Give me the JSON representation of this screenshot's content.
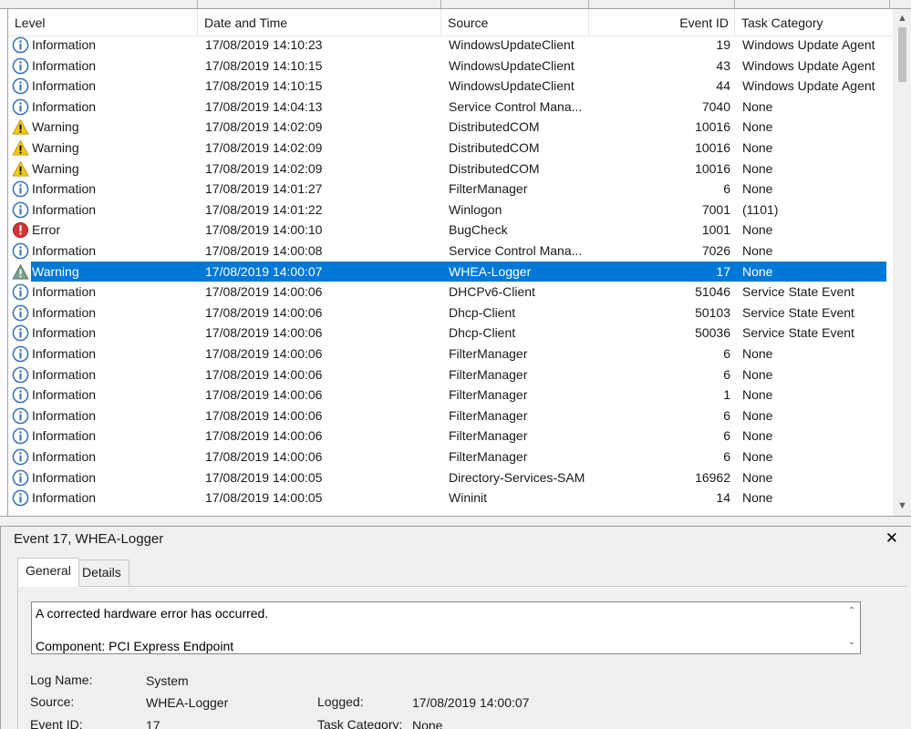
{
  "grid": {
    "columns": [
      {
        "label": "Level"
      },
      {
        "label": "Date and Time"
      },
      {
        "label": "Source"
      },
      {
        "label": "Event ID"
      },
      {
        "label": "Task Category"
      }
    ],
    "rows": [
      {
        "level": "Information",
        "icon": "info-icon",
        "date": "17/08/2019 14:10:23",
        "source": "WindowsUpdateClient",
        "id": "19",
        "task": "Windows Update Agent"
      },
      {
        "level": "Information",
        "icon": "info-icon",
        "date": "17/08/2019 14:10:15",
        "source": "WindowsUpdateClient",
        "id": "43",
        "task": "Windows Update Agent"
      },
      {
        "level": "Information",
        "icon": "info-icon",
        "date": "17/08/2019 14:10:15",
        "source": "WindowsUpdateClient",
        "id": "44",
        "task": "Windows Update Agent"
      },
      {
        "level": "Information",
        "icon": "info-icon",
        "date": "17/08/2019 14:04:13",
        "source": "Service Control Mana...",
        "id": "7040",
        "task": "None"
      },
      {
        "level": "Warning",
        "icon": "warning-icon",
        "date": "17/08/2019 14:02:09",
        "source": "DistributedCOM",
        "id": "10016",
        "task": "None"
      },
      {
        "level": "Warning",
        "icon": "warning-icon",
        "date": "17/08/2019 14:02:09",
        "source": "DistributedCOM",
        "id": "10016",
        "task": "None"
      },
      {
        "level": "Warning",
        "icon": "warning-icon",
        "date": "17/08/2019 14:02:09",
        "source": "DistributedCOM",
        "id": "10016",
        "task": "None"
      },
      {
        "level": "Information",
        "icon": "info-icon",
        "date": "17/08/2019 14:01:27",
        "source": "FilterManager",
        "id": "6",
        "task": "None"
      },
      {
        "level": "Information",
        "icon": "info-icon",
        "date": "17/08/2019 14:01:22",
        "source": "Winlogon",
        "id": "7001",
        "task": "(1101)"
      },
      {
        "level": "Error",
        "icon": "error-icon",
        "date": "17/08/2019 14:00:10",
        "source": "BugCheck",
        "id": "1001",
        "task": "None"
      },
      {
        "level": "Information",
        "icon": "info-icon",
        "date": "17/08/2019 14:00:08",
        "source": "Service Control Mana...",
        "id": "7026",
        "task": "None"
      },
      {
        "level": "Warning",
        "icon": "warning-icon",
        "date": "17/08/2019 14:00:07",
        "source": "WHEA-Logger",
        "id": "17",
        "task": "None",
        "selected": true
      },
      {
        "level": "Information",
        "icon": "info-icon",
        "date": "17/08/2019 14:00:06",
        "source": "DHCPv6-Client",
        "id": "51046",
        "task": "Service State Event"
      },
      {
        "level": "Information",
        "icon": "info-icon",
        "date": "17/08/2019 14:00:06",
        "source": "Dhcp-Client",
        "id": "50103",
        "task": "Service State Event"
      },
      {
        "level": "Information",
        "icon": "info-icon",
        "date": "17/08/2019 14:00:06",
        "source": "Dhcp-Client",
        "id": "50036",
        "task": "Service State Event"
      },
      {
        "level": "Information",
        "icon": "info-icon",
        "date": "17/08/2019 14:00:06",
        "source": "FilterManager",
        "id": "6",
        "task": "None"
      },
      {
        "level": "Information",
        "icon": "info-icon",
        "date": "17/08/2019 14:00:06",
        "source": "FilterManager",
        "id": "6",
        "task": "None"
      },
      {
        "level": "Information",
        "icon": "info-icon",
        "date": "17/08/2019 14:00:06",
        "source": "FilterManager",
        "id": "1",
        "task": "None"
      },
      {
        "level": "Information",
        "icon": "info-icon",
        "date": "17/08/2019 14:00:06",
        "source": "FilterManager",
        "id": "6",
        "task": "None"
      },
      {
        "level": "Information",
        "icon": "info-icon",
        "date": "17/08/2019 14:00:06",
        "source": "FilterManager",
        "id": "6",
        "task": "None"
      },
      {
        "level": "Information",
        "icon": "info-icon",
        "date": "17/08/2019 14:00:06",
        "source": "FilterManager",
        "id": "6",
        "task": "None"
      },
      {
        "level": "Information",
        "icon": "info-icon",
        "date": "17/08/2019 14:00:05",
        "source": "Directory-Services-SAM",
        "id": "16962",
        "task": "None"
      },
      {
        "level": "Information",
        "icon": "info-icon",
        "date": "17/08/2019 14:00:05",
        "source": "Wininit",
        "id": "14",
        "task": "None"
      }
    ]
  },
  "detail": {
    "title": "Event 17, WHEA-Logger",
    "tabs": [
      {
        "label": "General"
      },
      {
        "label": "Details"
      }
    ],
    "message_line1": "A corrected hardware error has occurred.",
    "message_line2": "Component: PCI Express Endpoint",
    "log_name_label": "Log Name:",
    "log_name": "System",
    "source_label": "Source:",
    "source": "WHEA-Logger",
    "logged_label": "Logged:",
    "logged": "17/08/2019 14:00:07",
    "event_id_label": "Event ID:",
    "event_id": "17",
    "task_category_label": "Task Category:",
    "task_category": "None"
  },
  "colors": {
    "selection": "#0078d7",
    "info_icon": "#3b6fb6",
    "warning_icon": "#f2c811",
    "error_icon": "#d13438"
  }
}
